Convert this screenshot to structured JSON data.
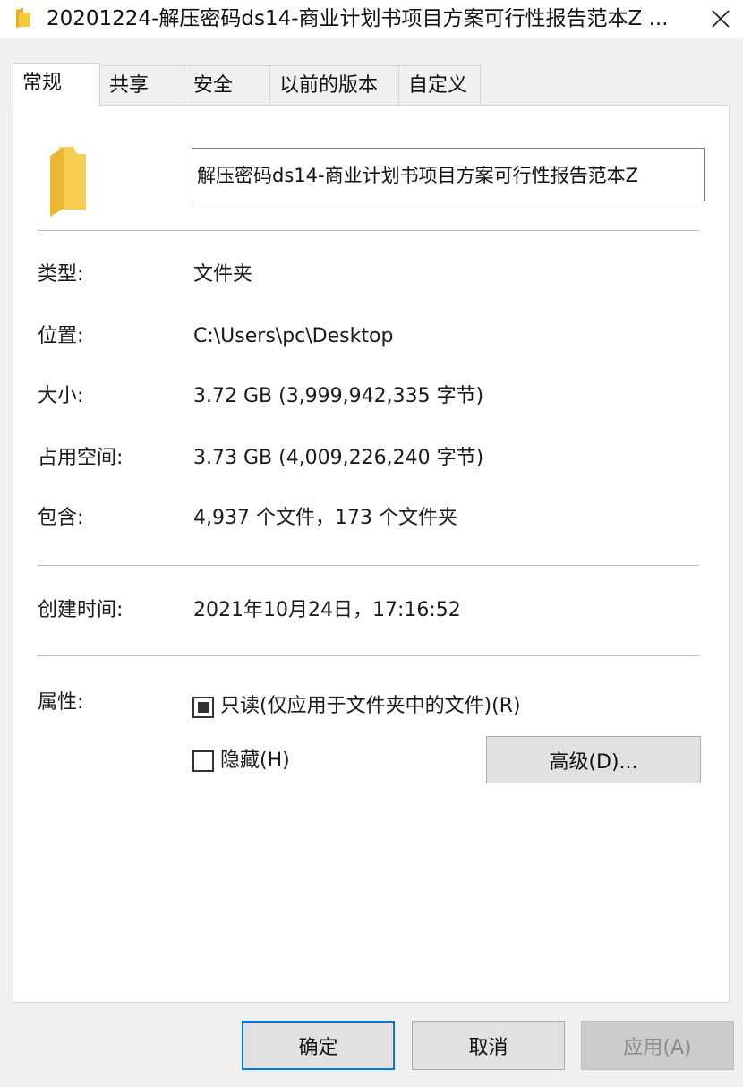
{
  "window": {
    "title": "20201224-解压密码ds14-商业计划书项目方案可行性报告范本Z ..."
  },
  "tabs": [
    {
      "label": "常规",
      "active": true
    },
    {
      "label": "共享"
    },
    {
      "label": "安全"
    },
    {
      "label": "以前的版本"
    },
    {
      "label": "自定义"
    }
  ],
  "general": {
    "name_value": "解压密码ds14-商业计划书项目方案可行性报告范本Z",
    "rows": [
      {
        "label": "类型:",
        "value": "文件夹"
      },
      {
        "label": "位置:",
        "value": "C:\\Users\\pc\\Desktop"
      },
      {
        "label": "大小:",
        "value": "3.72 GB (3,999,942,335 字节)"
      },
      {
        "label": "占用空间:",
        "value": "3.73 GB (4,009,226,240 字节)"
      },
      {
        "label": "包含:",
        "value": "4,937 个文件，173 个文件夹"
      }
    ],
    "created_label": "创建时间:",
    "created_value": "2021年10月24日，17:16:52",
    "attributes_label": "属性:",
    "readonly_label": "只读(仅应用于文件夹中的文件)(R)",
    "hidden_label": "隐藏(H)",
    "advanced_label": "高级(D)..."
  },
  "buttons": {
    "ok": "确定",
    "cancel": "取消",
    "apply": "应用(A)"
  },
  "colors": {
    "folder": "#f5c842",
    "accent": "#0078d7"
  }
}
